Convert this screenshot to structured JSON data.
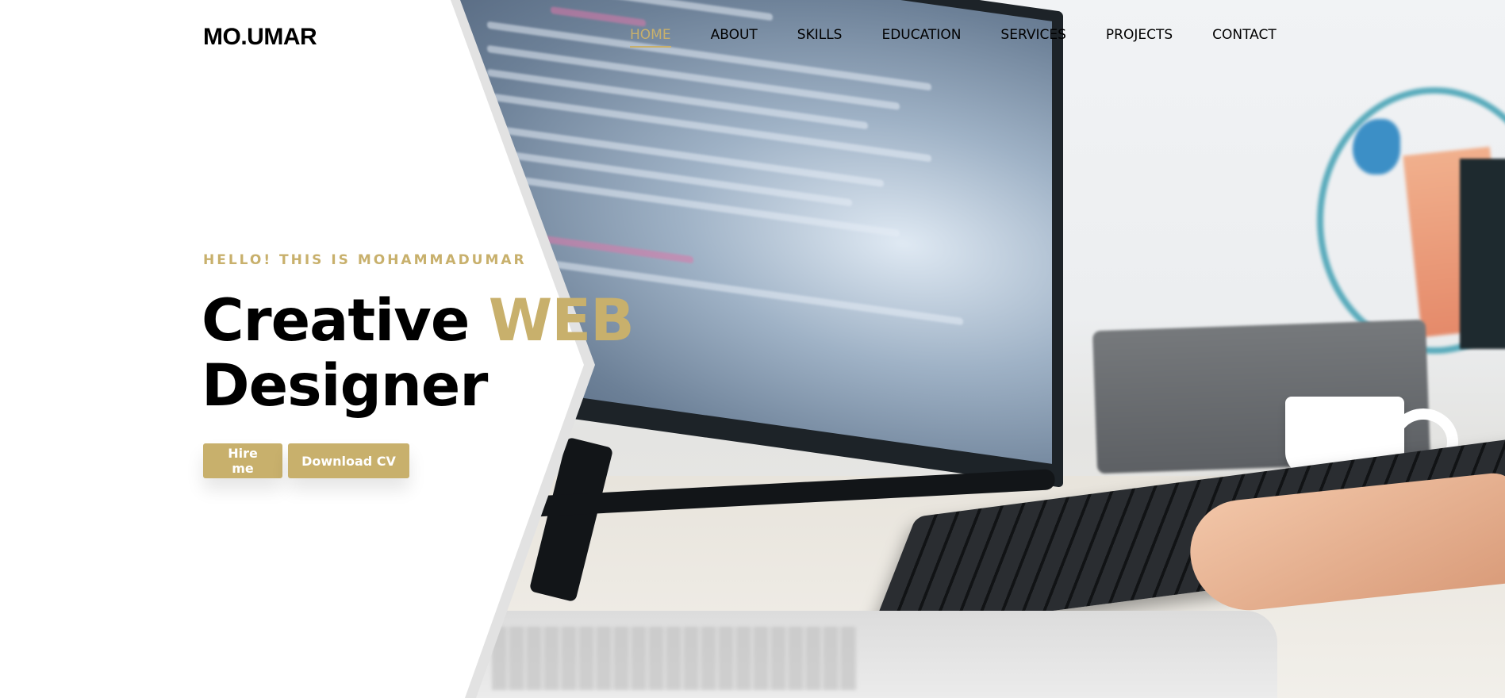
{
  "brand": {
    "logo_text": "MO.UMAR"
  },
  "nav": {
    "items": [
      {
        "label": "HOME",
        "active": true
      },
      {
        "label": "ABOUT",
        "active": false
      },
      {
        "label": "SKILLS",
        "active": false
      },
      {
        "label": "EDUCATION",
        "active": false
      },
      {
        "label": "SERVICES",
        "active": false
      },
      {
        "label": "PROJECTS",
        "active": false
      },
      {
        "label": "CONTACT",
        "active": false
      }
    ]
  },
  "hero": {
    "kicker": "HELLO! THIS IS MOHAMMADUMAR",
    "title_part1": "Creative ",
    "title_accent": "WEB",
    "title_part2": "Designer",
    "buttons": {
      "hire": "Hire me",
      "download": "Download CV"
    }
  },
  "colors": {
    "accent": "#c8b06c",
    "text": "#000000",
    "background": "#ffffff"
  }
}
